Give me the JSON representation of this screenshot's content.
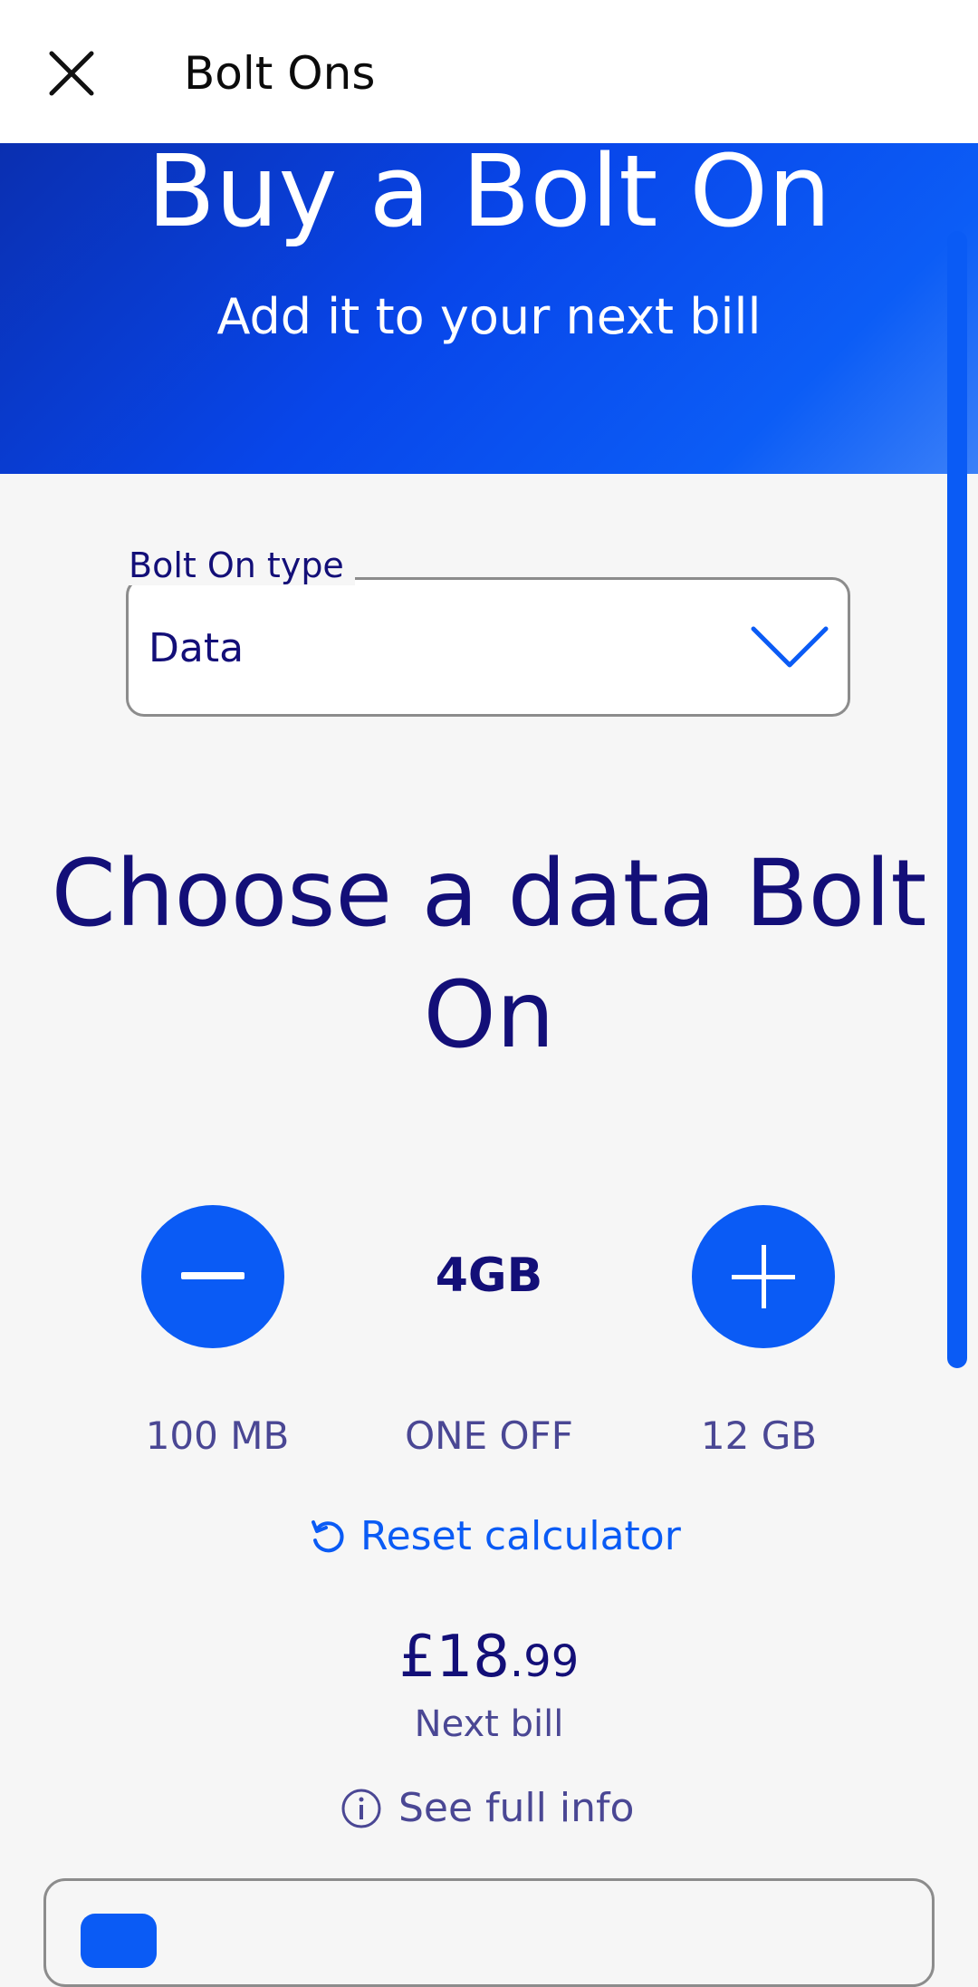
{
  "header": {
    "title": "Bolt Ons",
    "close_icon": "close-icon"
  },
  "hero": {
    "title": "Buy a Bolt On",
    "subtitle": "Add it to your next bill"
  },
  "bolt_on_type": {
    "label": "Bolt On type",
    "value": "Data",
    "icon": "chevron-down-icon"
  },
  "heading": "Choose a data Bolt On",
  "stepper": {
    "value": "4GB",
    "min_label": "100 MB",
    "mid_label": "ONE OFF",
    "max_label": "12 GB",
    "minus_icon": "minus-icon",
    "plus_icon": "plus-icon"
  },
  "reset": {
    "label": "Reset calculator",
    "icon": "refresh-icon"
  },
  "price": {
    "main": "£18",
    "decimals": ".99",
    "caption": "Next bill"
  },
  "info": {
    "label": "See full info",
    "icon": "info-icon"
  },
  "colors": {
    "accent": "#0a5bf5",
    "navy": "#130f78",
    "text_muted": "#4a4794"
  }
}
